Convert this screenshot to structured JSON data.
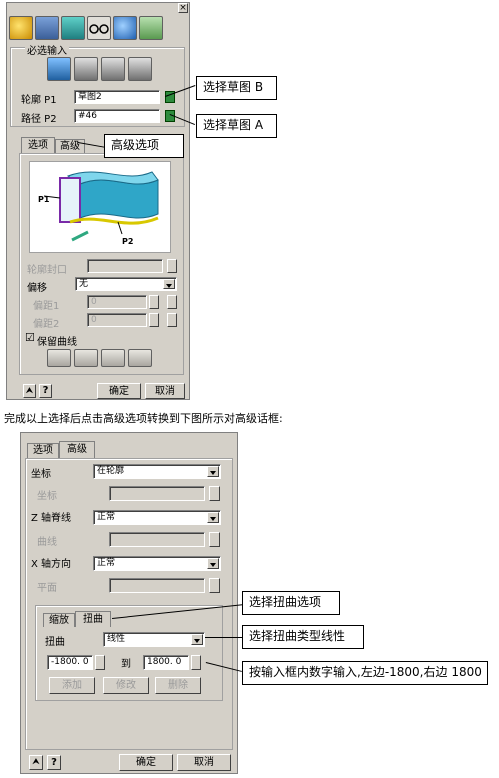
{
  "top_panel": {
    "close_glyph": "×",
    "group_required": "必选输入",
    "profile_label": "轮廓 P1",
    "profile_value": "草图2",
    "path_label": "路径 P2",
    "path_value": "#46",
    "tabs": [
      "选项",
      "高级"
    ],
    "diagram_p1": "P1",
    "diagram_p2": "P2",
    "profile_cap_label": "轮廓封口",
    "offset_label": "偏移",
    "offset_value": "无",
    "offset1_label": "偏距1",
    "offset1_value": "0",
    "offset2_label": "偏距2",
    "offset2_value": "0",
    "keep_curve_label": "保留曲线",
    "keep_curve_check": "☑",
    "ok_label": "确定",
    "cancel_label": "取消",
    "expand_glyph": "⮝",
    "help_glyph": "?"
  },
  "callouts": {
    "select_b": "选择草图 B",
    "select_a": "选择草图 A",
    "advanced": "高级选项",
    "twist_option": "选择扭曲选项",
    "twist_type": "选择扭曲类型线性",
    "input_values": "按输入框内数字输入,左边-1800,右边 1800"
  },
  "instruction_text": "完成以上选择后点击高级选项转换到下图所示对高级话框:",
  "bottom_panel": {
    "tabs": [
      "选项",
      "高级"
    ],
    "coord_label": "坐标",
    "coord_value": "在轮廓",
    "coord_sub_label": "坐标",
    "z_spine_label": "Z 轴脊线",
    "z_spine_value": "正常",
    "curve_label": "曲线",
    "x_dir_label": "X 轴方向",
    "x_dir_value": "正常",
    "plane_label": "平面",
    "sub_tabs": [
      "缩放",
      "扭曲"
    ],
    "twist_label": "扭曲",
    "twist_value": "线性",
    "left_value": "-1800. 0",
    "to_label": "到",
    "right_value": "1800. 0",
    "add_label": "添加",
    "modify_label": "修改",
    "delete_label": "删除",
    "ok_label": "确定",
    "cancel_label": "取消",
    "expand_glyph": "⮝",
    "help_glyph": "?"
  }
}
